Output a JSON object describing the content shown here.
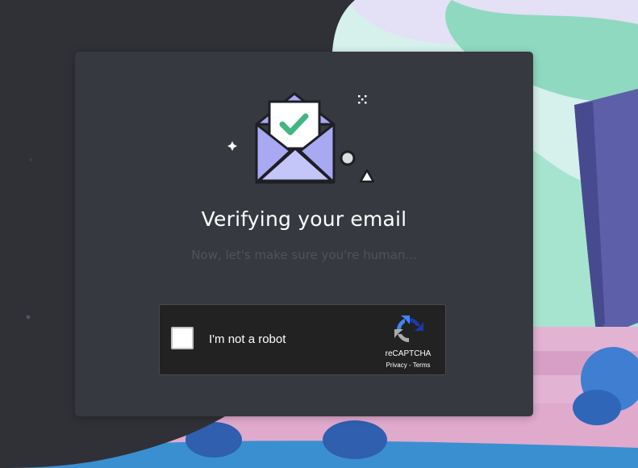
{
  "dialog": {
    "title": "Verifying your email",
    "subtitle": "Now, let's make sure you're human..."
  },
  "captcha": {
    "checkbox_label": "I'm not a robot",
    "brand": "reCAPTCHA",
    "privacy_link": "Privacy",
    "separator": " - ",
    "terms_link": "Terms"
  },
  "colors": {
    "card_background": "#36393f",
    "title_text": "#ffffff",
    "subtitle_text": "#4f545c",
    "envelope": "#a8a9f2",
    "checkmark": "#43b581",
    "background_dark": "#2f3136",
    "background_scene": "#a8e0d8"
  },
  "icons": {
    "illustration": "envelope-with-checkmark-letter",
    "captcha_logo": "recaptcha-logo-icon"
  }
}
